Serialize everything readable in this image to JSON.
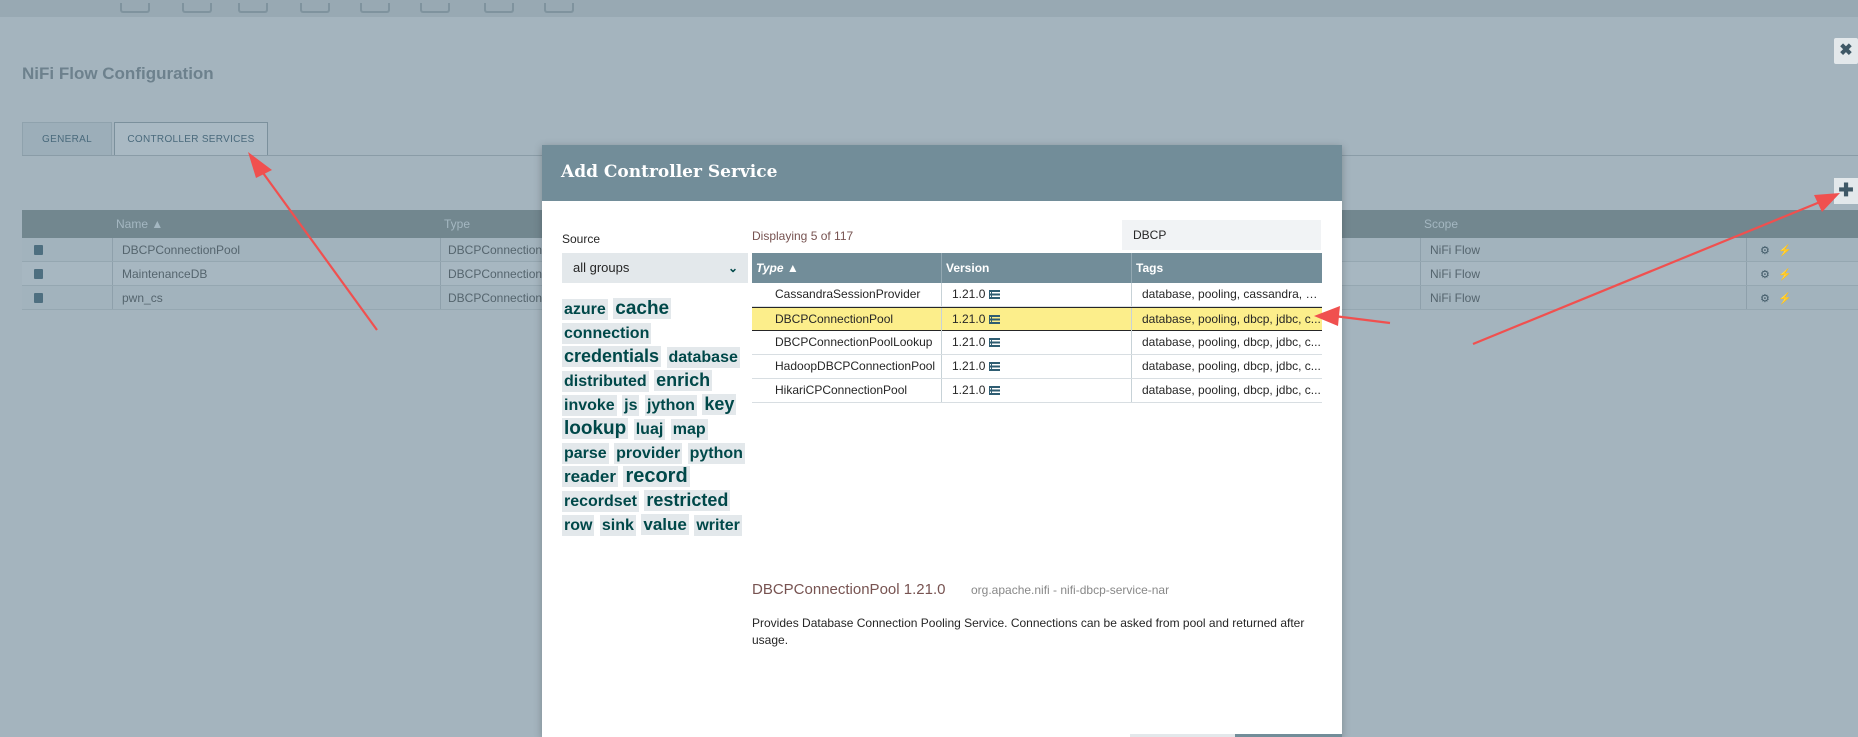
{
  "window_title": "NiFi Flow Configuration",
  "tabs": [
    {
      "label": "GENERAL"
    },
    {
      "label": "CONTROLLER SERVICES"
    }
  ],
  "bg_table": {
    "headers": [
      "Name ▲",
      "Type",
      "Scope"
    ],
    "rows": [
      {
        "name": "DBCPConnectionPool",
        "type": "DBCPConnection",
        "scope": "NiFi Flow"
      },
      {
        "name": "MaintenanceDB",
        "type": "DBCPConnection",
        "scope": "NiFi Flow"
      },
      {
        "name": "pwn_cs",
        "type": "DBCPConnection",
        "scope": "NiFi Flow"
      }
    ]
  },
  "dialog": {
    "title": "Add Controller Service",
    "source_label": "Source",
    "source_value": "all groups",
    "tags": [
      {
        "label": "azure",
        "size": 16
      },
      {
        "label": "cache",
        "size": 19
      },
      {
        "label": "connection",
        "size": 16
      },
      {
        "label": "credentials",
        "size": 18
      },
      {
        "label": "database",
        "size": 16
      },
      {
        "label": "distributed",
        "size": 16
      },
      {
        "label": "enrich",
        "size": 18
      },
      {
        "label": "invoke",
        "size": 16
      },
      {
        "label": "js",
        "size": 16
      },
      {
        "label": "jython",
        "size": 16
      },
      {
        "label": "key",
        "size": 18
      },
      {
        "label": "lookup",
        "size": 19
      },
      {
        "label": "luaj",
        "size": 16
      },
      {
        "label": "map",
        "size": 16
      },
      {
        "label": "parse",
        "size": 16
      },
      {
        "label": "provider",
        "size": 16
      },
      {
        "label": "python",
        "size": 16
      },
      {
        "label": "reader",
        "size": 17
      },
      {
        "label": "record",
        "size": 20
      },
      {
        "label": "recordset",
        "size": 16
      },
      {
        "label": "restricted",
        "size": 18
      },
      {
        "label": "row",
        "size": 16
      },
      {
        "label": "sink",
        "size": 16
      },
      {
        "label": "value",
        "size": 17
      },
      {
        "label": "writer",
        "size": 16
      }
    ],
    "displaying": "Displaying 5 of 117",
    "filter_value": "DBCP",
    "columns": [
      "Type ▲",
      "Version",
      "Tags"
    ],
    "rows": [
      {
        "type": "CassandraSessionProvider",
        "version": "1.21.0",
        "tags": "database, pooling, cassandra, d...",
        "selected": false
      },
      {
        "type": "DBCPConnectionPool",
        "version": "1.21.0",
        "tags": "database, pooling, dbcp, jdbc, c...",
        "selected": true
      },
      {
        "type": "DBCPConnectionPoolLookup",
        "version": "1.21.0",
        "tags": "database, pooling, dbcp, jdbc, c...",
        "selected": false
      },
      {
        "type": "HadoopDBCPConnectionPool",
        "version": "1.21.0",
        "tags": "database, pooling, dbcp, jdbc, c...",
        "selected": false
      },
      {
        "type": "HikariCPConnectionPool",
        "version": "1.21.0",
        "tags": "database, pooling, dbcp, jdbc, c...",
        "selected": false
      }
    ],
    "detail": {
      "title": "DBCPConnectionPool 1.21.0",
      "bundle": "org.apache.nifi - nifi-dbcp-service-nar",
      "description": "Provides Database Connection Pooling Service. Connections can be asked from pool and returned after usage."
    }
  },
  "colors": {
    "header": "#728d99",
    "selected_row": "#fcee8b",
    "accent_text": "#775351",
    "arrow": "#f0504f"
  }
}
